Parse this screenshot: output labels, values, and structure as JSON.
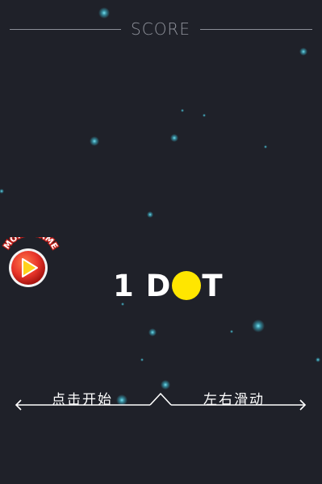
{
  "header": {
    "score_label": "SCORE"
  },
  "title": {
    "prefix": "1 D",
    "suffix": "T",
    "dot_color": "#ffe600"
  },
  "more_game": {
    "label": "MORE GAME",
    "icon": "play-icon",
    "badge_color": "#e8352a"
  },
  "controls": {
    "tap_hint": "点击开始",
    "swipe_hint": "左右滑动",
    "left_arrow_icon": "arrow-left-icon",
    "right_arrow_icon": "arrow-right-icon"
  },
  "colors": {
    "background": "#1f2129",
    "particle": "#4fd6e8",
    "text": "#ffffff",
    "muted": "#8f929b"
  }
}
